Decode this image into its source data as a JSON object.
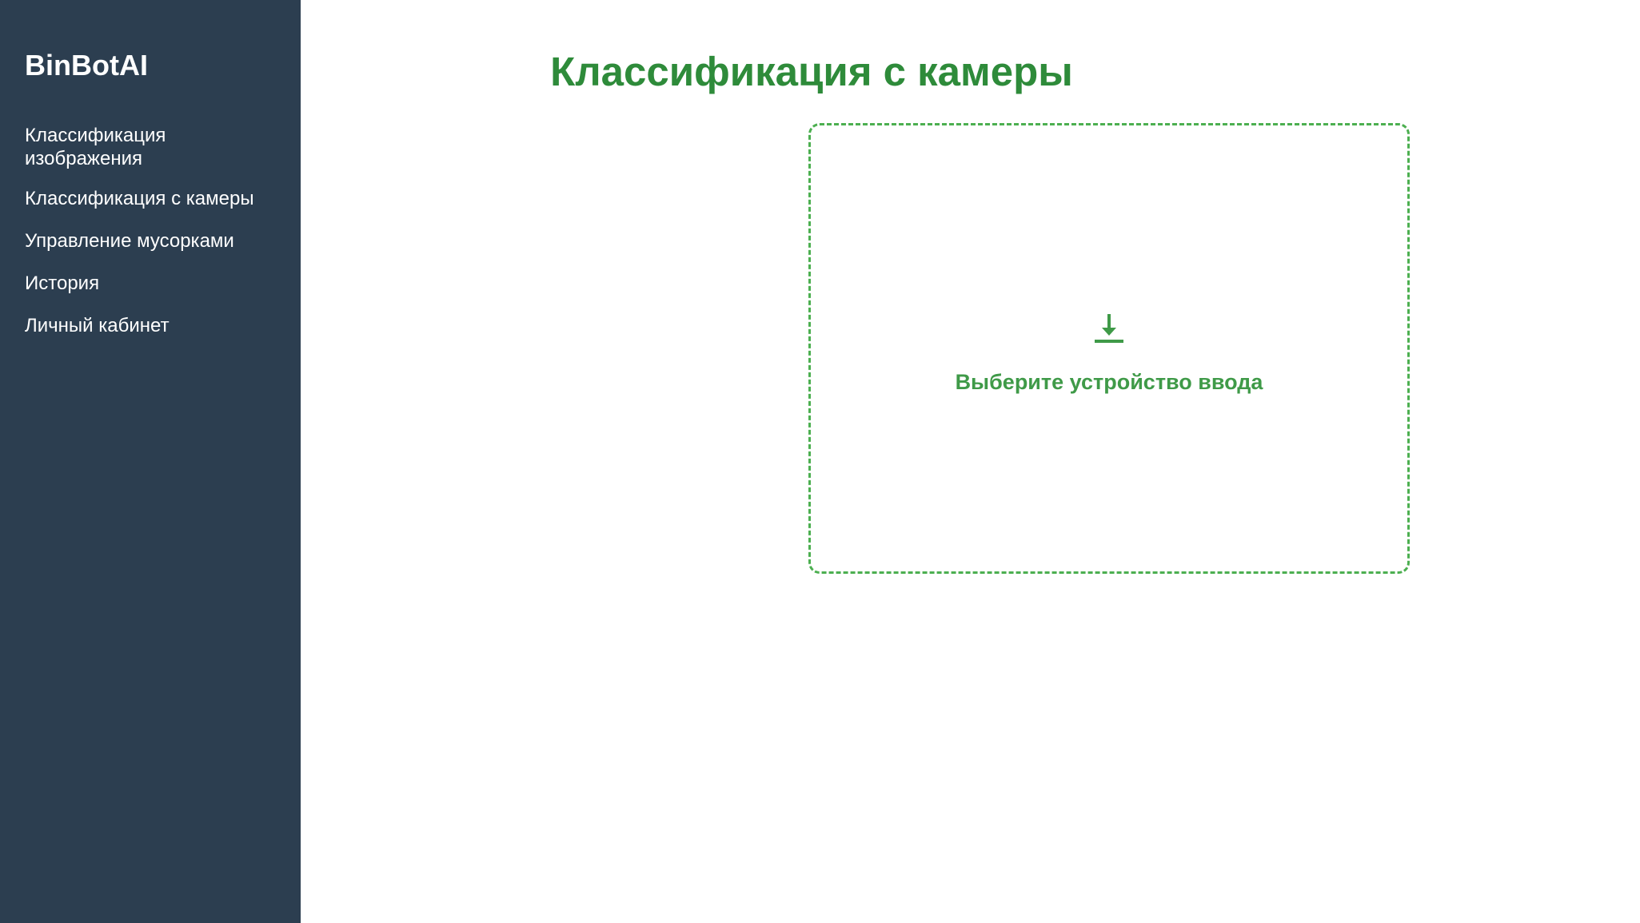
{
  "sidebar": {
    "brand": "BinBotAI",
    "items": [
      {
        "label": "Классификация изображения"
      },
      {
        "label": "Классификация с камеры"
      },
      {
        "label": "Управление мусорками"
      },
      {
        "label": "История"
      },
      {
        "label": "Личный кабинет"
      }
    ]
  },
  "main": {
    "title": "Классификация с камеры",
    "dropzone": {
      "icon": "download-icon",
      "text": "Выберите устройство ввода"
    }
  },
  "colors": {
    "sidebar_bg": "#2c3e50",
    "accent_green": "#2e8b3a",
    "dropzone_border": "#4caf50"
  }
}
